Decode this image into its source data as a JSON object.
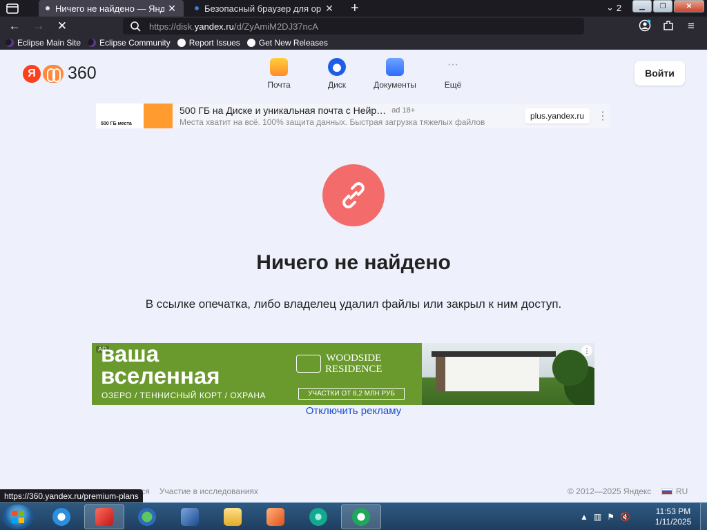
{
  "browser": {
    "tabs": [
      {
        "label": "Ничего не найдено — Яндекс.Диск",
        "active": true
      },
      {
        "label": "Безопасный браузер для организаций",
        "active": false
      }
    ],
    "tab_count": "2",
    "url_prefix": "https://disk.",
    "url_host": "yandex.ru",
    "url_path": "/d/ZyAmiM2DJ37ncA",
    "bookmarks": [
      "Eclipse Main Site",
      "Eclipse Community",
      "Report Issues",
      "Get New Releases"
    ]
  },
  "header": {
    "logo_text": "360",
    "logo_letter": "Я",
    "services": [
      "Почта",
      "Диск",
      "Документы",
      "Ещё"
    ],
    "login_label": "Войти"
  },
  "ad_top": {
    "title": "500 ГБ на Диске и уникальная почта с Нейр…",
    "badge": "ad  18+",
    "desc": "Места хватит на всё. 100% защита данных. Быстрая загрузка тяжелых файлов",
    "domain": "plus.yandex.ru",
    "thumb_text": "500 ГБ места"
  },
  "error": {
    "title": "Ничего не найдено",
    "message": "В ссылке опечатка, либо владелец удалил файлы или закрыл к ним доступ."
  },
  "banner": {
    "ad_label": "AD",
    "headline_1": "ваша",
    "headline_2": "вселенная",
    "features": "ОЗЕРО  /  ТЕННИСНЫЙ КОРТ  /  ОХРАНА",
    "brand_1": "WOODSIDE",
    "brand_2": "RESIDENCE",
    "price": "УЧАСТКИ ОТ 8,2 МЛН РУБ"
  },
  "disable_ad": "Отключить рекламу",
  "footer": {
    "links": [
      "…ваться",
      "Участие в исследованиях"
    ],
    "copyright": "© 2012—2025 Яндекс",
    "lang": "RU"
  },
  "status_url": "https://360.yandex.ru/premium-plans",
  "taskbar": {
    "time": "11:53 PM",
    "date": "1/11/2025"
  },
  "colors": {
    "accent_error": "#f36b6b",
    "page_bg": "#eef1fb",
    "link": "#1a4fcf"
  }
}
